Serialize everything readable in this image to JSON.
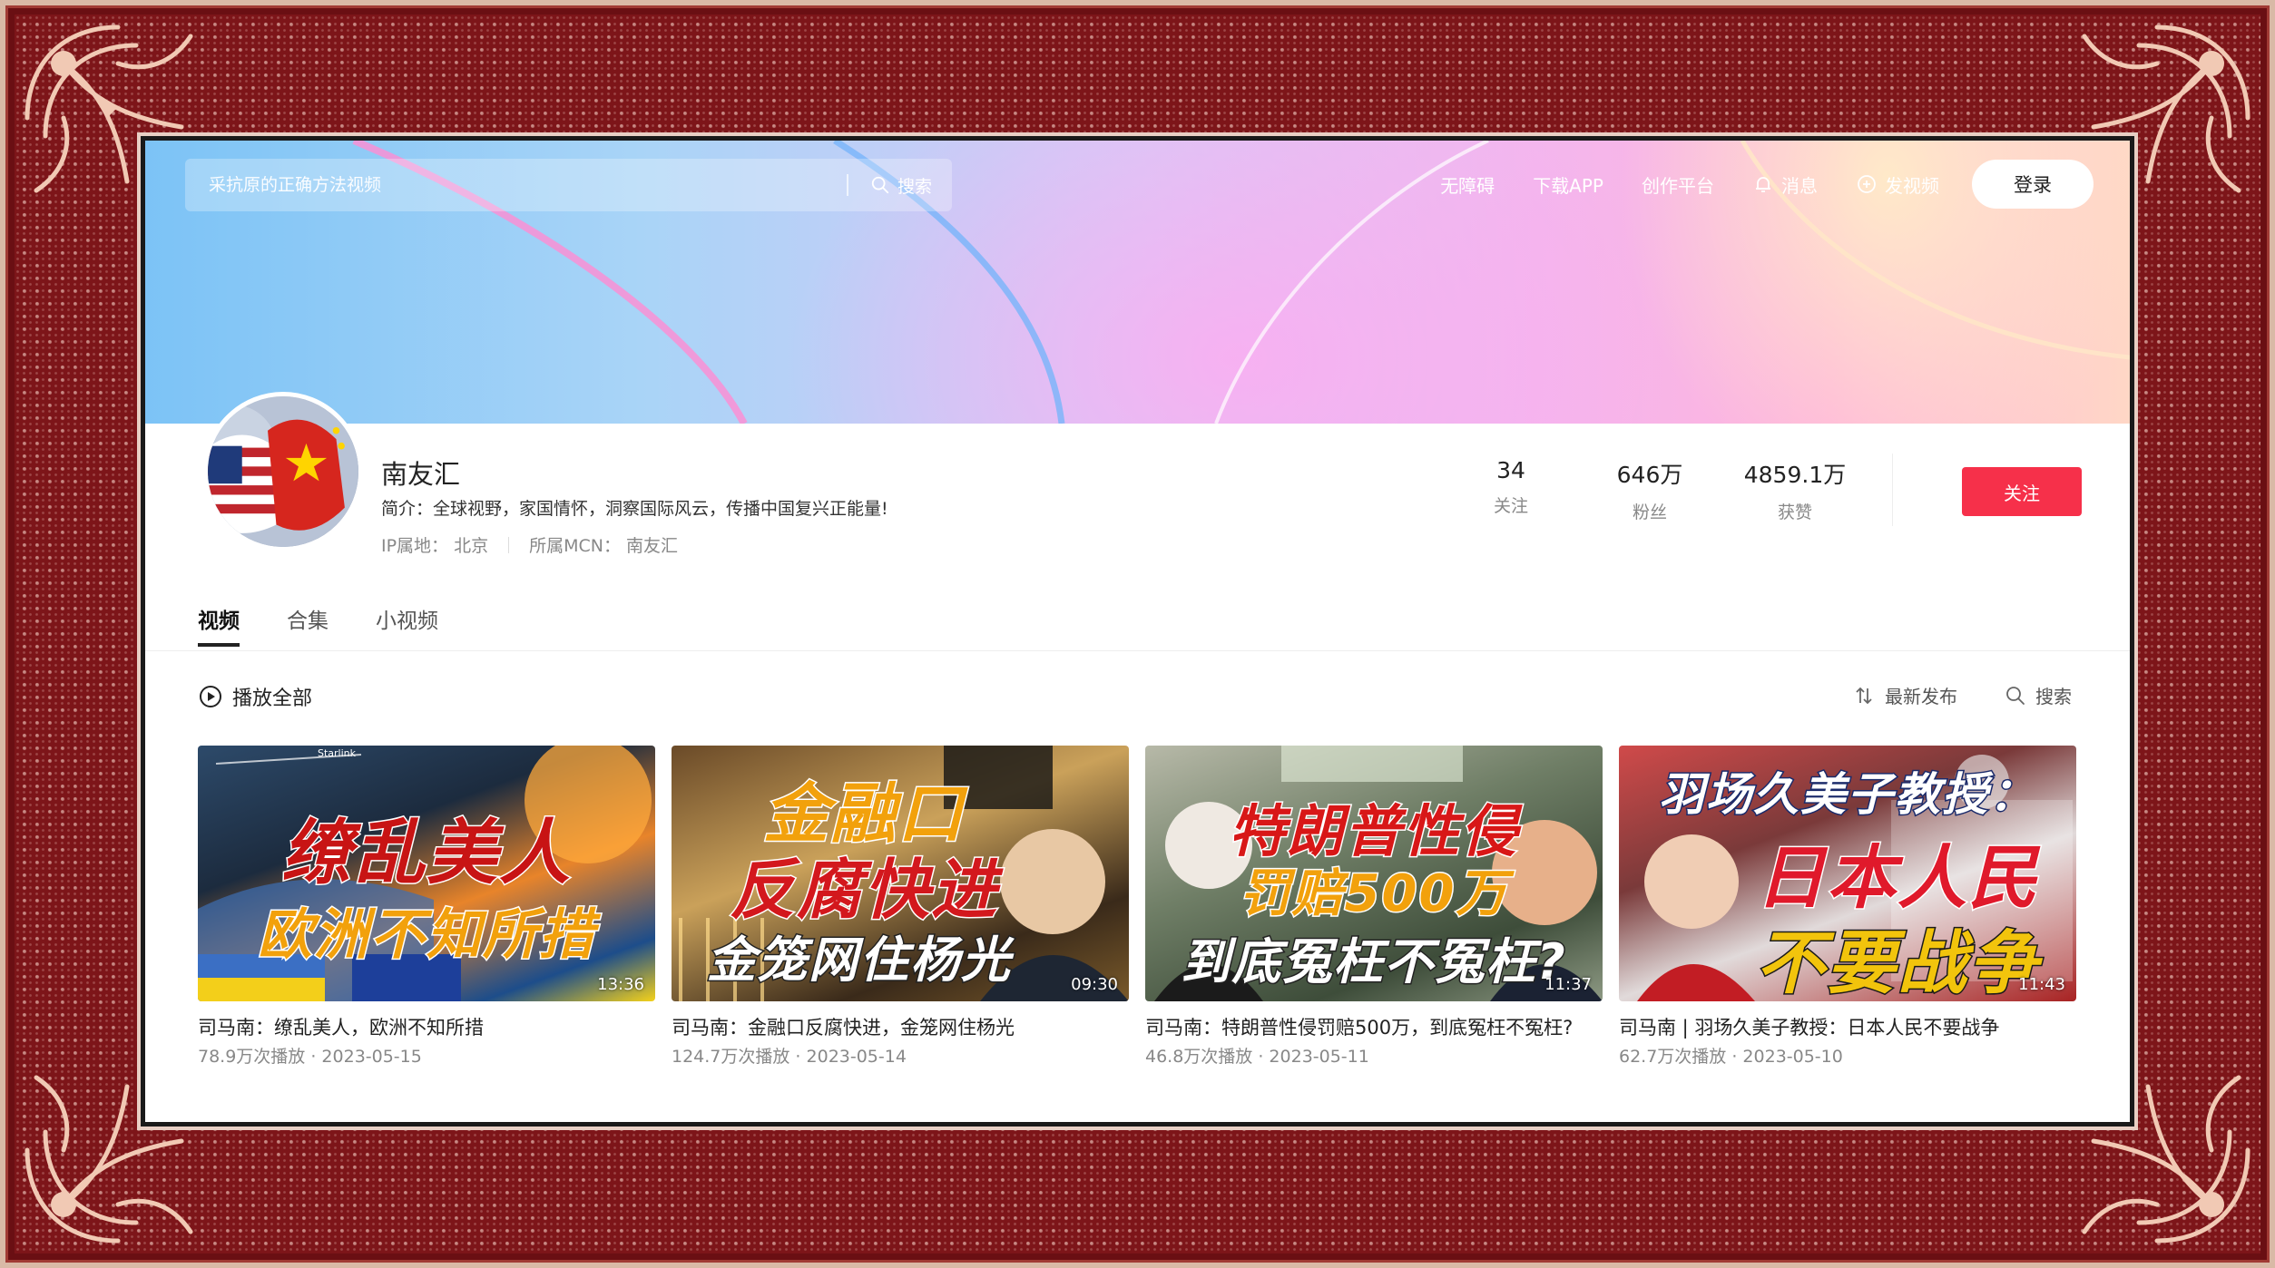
{
  "search": {
    "placeholder": "采抗原的正确方法视频",
    "button_label": "搜索"
  },
  "nav": {
    "accessibility": "无障碍",
    "download_app": "下载APP",
    "creator_platform": "创作平台",
    "messages": "消息",
    "upload": "发视频",
    "login": "登录"
  },
  "profile": {
    "name": "南友汇",
    "bio": "简介：全球视野，家国情怀，洞察国际风云，传播中国复兴正能量!",
    "ip_location": "IP属地：  北京",
    "mcn": "所属MCN：  南友汇",
    "stats": [
      {
        "value": "34",
        "label": "关注"
      },
      {
        "value": "646万",
        "label": "粉丝"
      },
      {
        "value": "4859.1万",
        "label": "获赞"
      }
    ],
    "follow_label": "关注"
  },
  "tabs": [
    {
      "label": "视频",
      "active": true
    },
    {
      "label": "合集",
      "active": false
    },
    {
      "label": "小视频",
      "active": false
    }
  ],
  "toolbar": {
    "play_all": "播放全部",
    "sort": "最新发布",
    "search": "搜索"
  },
  "videos": [
    {
      "thumb_lines": [
        "缭乱美人",
        "欧洲不知所措"
      ],
      "thumb_small": "Starlink",
      "duration": "13:36",
      "title": "司马南：缭乱美人，欧洲不知所措",
      "meta": "78.9万次播放 · 2023-05-15"
    },
    {
      "thumb_lines": [
        "金融口",
        "反腐快进",
        "金笼网住杨光"
      ],
      "duration": "09:30",
      "title": "司马南：金融口反腐快进，金笼网住杨光",
      "meta": "124.7万次播放 · 2023-05-14"
    },
    {
      "thumb_lines": [
        "特朗普性侵",
        "罚赔500万",
        "到底冤枉不冤枉?"
      ],
      "duration": "11:37",
      "title": "司马南：特朗普性侵罚赔500万，到底冤枉不冤枉?",
      "meta": "46.8万次播放 · 2023-05-11"
    },
    {
      "thumb_lines": [
        "羽场久美子教授：",
        "日本人民",
        "不要战争"
      ],
      "duration": "11:43",
      "title": "司马南 | 羽场久美子教授：日本人民不要战争",
      "meta": "62.7万次播放 · 2023-05-10"
    }
  ],
  "colors": {
    "follow": "#f6304a",
    "frame": "#7d1519"
  }
}
